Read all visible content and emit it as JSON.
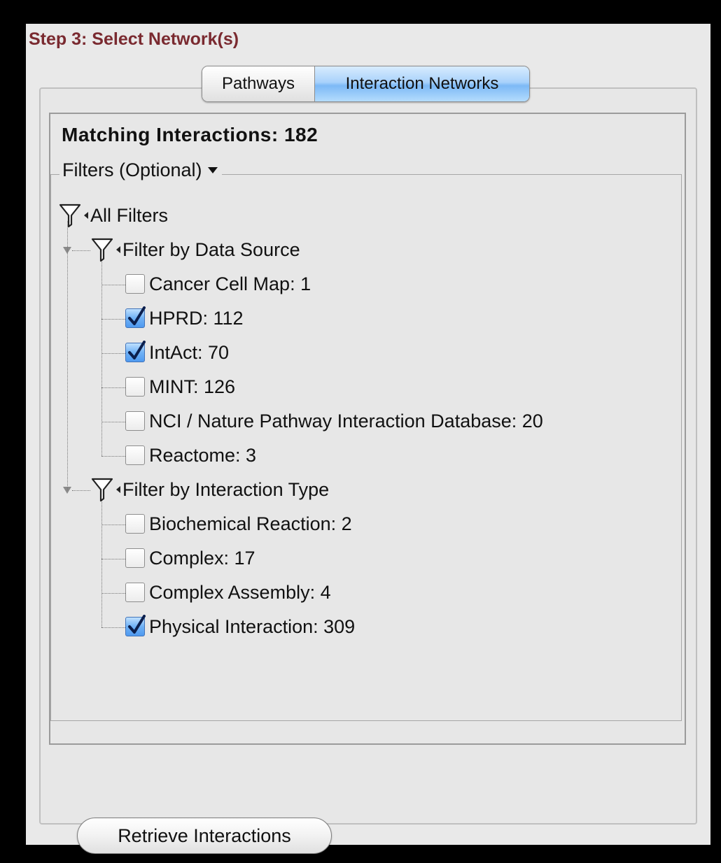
{
  "step_title": "Step 3:  Select Network(s)",
  "tabs": [
    {
      "label": "Pathways",
      "selected": false
    },
    {
      "label": "Interaction Networks",
      "selected": true
    }
  ],
  "matching": {
    "text": "Matching Interactions:  182"
  },
  "filters": {
    "legend": "Filters (Optional)",
    "root_label": "All Filters",
    "groups": [
      {
        "label": "Filter by Data Source",
        "items": [
          {
            "label": "Cancer Cell Map:  1",
            "checked": false
          },
          {
            "label": "HPRD:  112",
            "checked": true
          },
          {
            "label": "IntAct:  70",
            "checked": true
          },
          {
            "label": "MINT:  126",
            "checked": false
          },
          {
            "label": "NCI / Nature Pathway Interaction Database:  20",
            "checked": false
          },
          {
            "label": "Reactome:  3",
            "checked": false
          }
        ]
      },
      {
        "label": "Filter by Interaction Type",
        "items": [
          {
            "label": "Biochemical Reaction:  2",
            "checked": false
          },
          {
            "label": "Complex:  17",
            "checked": false
          },
          {
            "label": "Complex Assembly:  4",
            "checked": false
          },
          {
            "label": "Physical Interaction:  309",
            "checked": true
          }
        ]
      }
    ]
  },
  "retrieve_button": "Retrieve Interactions",
  "colors": {
    "title": "#7a2a30",
    "selected_tab": "#a9d2fb",
    "checkbox_checked": "#4f9af0"
  },
  "icons": [
    "funnel-icon",
    "chevron-down-icon",
    "expand-triangle-icon",
    "checkmark-icon"
  ]
}
